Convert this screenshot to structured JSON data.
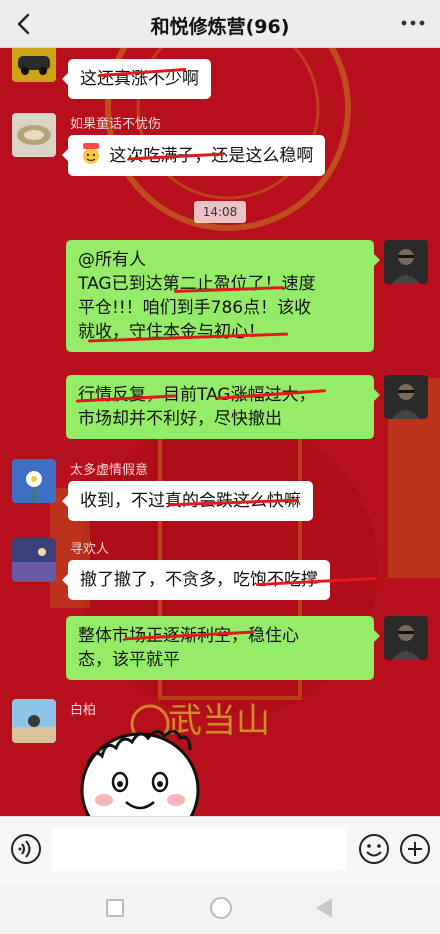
{
  "header": {
    "title": "和悦修炼营(96)",
    "back_icon": "chevron-left-icon",
    "more_icon": "more-dots-icon"
  },
  "chat": {
    "background_color": "#b80f1c",
    "background_text": "武当山",
    "timestamp": "14:08",
    "messages": [
      {
        "sender": "",
        "side": "left",
        "text": "这还真涨不少啊"
      },
      {
        "sender": "如果童话不忧伤",
        "side": "left",
        "text": "这次吃满子，还是这么稳啊",
        "emoji": "666"
      },
      {
        "sender": "",
        "side": "right",
        "lines": [
          "@所有人",
          "TAG已到达第二止盈位了！速度",
          "平仓!!！咱们到手786点！该收",
          "就收，守住本金与初心！"
        ]
      },
      {
        "sender": "",
        "side": "right",
        "lines": [
          "行情反复，目前TAG涨幅过大，",
          "市场却并不利好，尽快撤出"
        ]
      },
      {
        "sender": "太多虚情假意",
        "side": "left",
        "text": "收到，不过真的会跌这么快嘛"
      },
      {
        "sender": "寻欢人",
        "side": "left",
        "text": "撤了撤了，不贪多，吃饱不吃撑"
      },
      {
        "sender": "",
        "side": "right",
        "lines": [
          "整体市场正逐渐利空，稳住心",
          "态，该平就平"
        ]
      },
      {
        "sender": "白柏",
        "side": "left",
        "sticker": "smiling-face-sticker"
      }
    ]
  },
  "input_bar": {
    "voice_icon": "voice-icon",
    "emoji_icon": "emoji-icon",
    "plus_icon": "plus-icon",
    "input_value": ""
  },
  "colors": {
    "accent_green": "#95ec69",
    "strike_red": "#e31818"
  }
}
